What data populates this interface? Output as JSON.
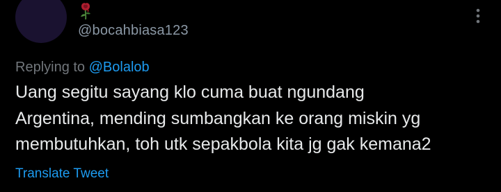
{
  "tweet": {
    "author": {
      "display_icon": "rose-icon",
      "handle": "@bocahbiasa123"
    },
    "more_icon": "more-horizontal-icon",
    "replying_prefix": "Replying to",
    "replying_to": "@Bolalob",
    "text_lines": [
      "Uang segitu sayang klo cuma buat ngundang",
      "Argentina, mending sumbangkan ke orang miskin yg",
      "membutuhkan, toh utk sepakbola kita jg gak kemana2"
    ],
    "translate_label": "Translate Tweet"
  },
  "colors": {
    "background": "#000000",
    "text": "#e7e9ea",
    "secondary_text": "#71767b",
    "link": "#1d9bf0"
  }
}
